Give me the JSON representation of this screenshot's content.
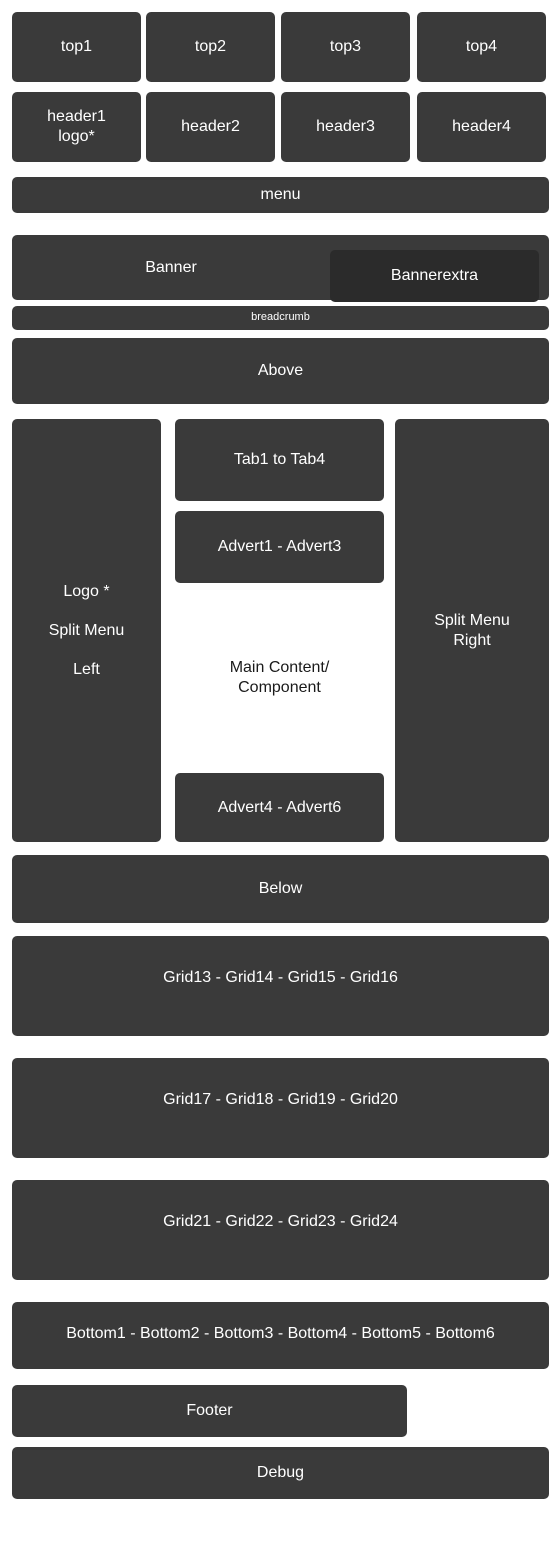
{
  "colors": {
    "block": "#3a3a3a",
    "block_dark": "#2b2b2b",
    "page_background": "#ffffff",
    "block_text": "#ffffff",
    "main_content_text": "#1a1a1a"
  },
  "top_row": {
    "items": [
      {
        "label": "top1"
      },
      {
        "label": "top2"
      },
      {
        "label": "top3"
      },
      {
        "label": "top4"
      }
    ]
  },
  "header_row": {
    "items": [
      {
        "label": "header1\nlogo*"
      },
      {
        "label": "header2"
      },
      {
        "label": "header3"
      },
      {
        "label": "header4"
      }
    ]
  },
  "menu": {
    "label": "menu"
  },
  "banner": {
    "label": "Banner",
    "extra_label": "Bannerextra"
  },
  "breadcrumb": {
    "label": "breadcrumb"
  },
  "above": {
    "label": "Above"
  },
  "main": {
    "left_column": {
      "line1": "Logo *",
      "line2": "Split Menu",
      "line3": "Left"
    },
    "center_column": {
      "tabs_label": "Tab1 to Tab4",
      "advert_top_label": "Advert1 - Advert3",
      "content_label": "Main Content/\nComponent",
      "advert_bottom_label": "Advert4 - Advert6"
    },
    "right_column": {
      "line1": "Split Menu",
      "line2": "Right"
    }
  },
  "below": {
    "label": "Below"
  },
  "grid_rows": [
    {
      "label": "Grid13 - Grid14 - Grid15 - Grid16"
    },
    {
      "label": "Grid17 - Grid18 - Grid19 - Grid20"
    },
    {
      "label": "Grid21 - Grid22 - Grid23 - Grid24"
    }
  ],
  "bottom": {
    "label": "Bottom1 - Bottom2 - Bottom3 - Bottom4 - Bottom5 - Bottom6"
  },
  "footer": {
    "label": "Footer"
  },
  "debug": {
    "label": "Debug"
  }
}
